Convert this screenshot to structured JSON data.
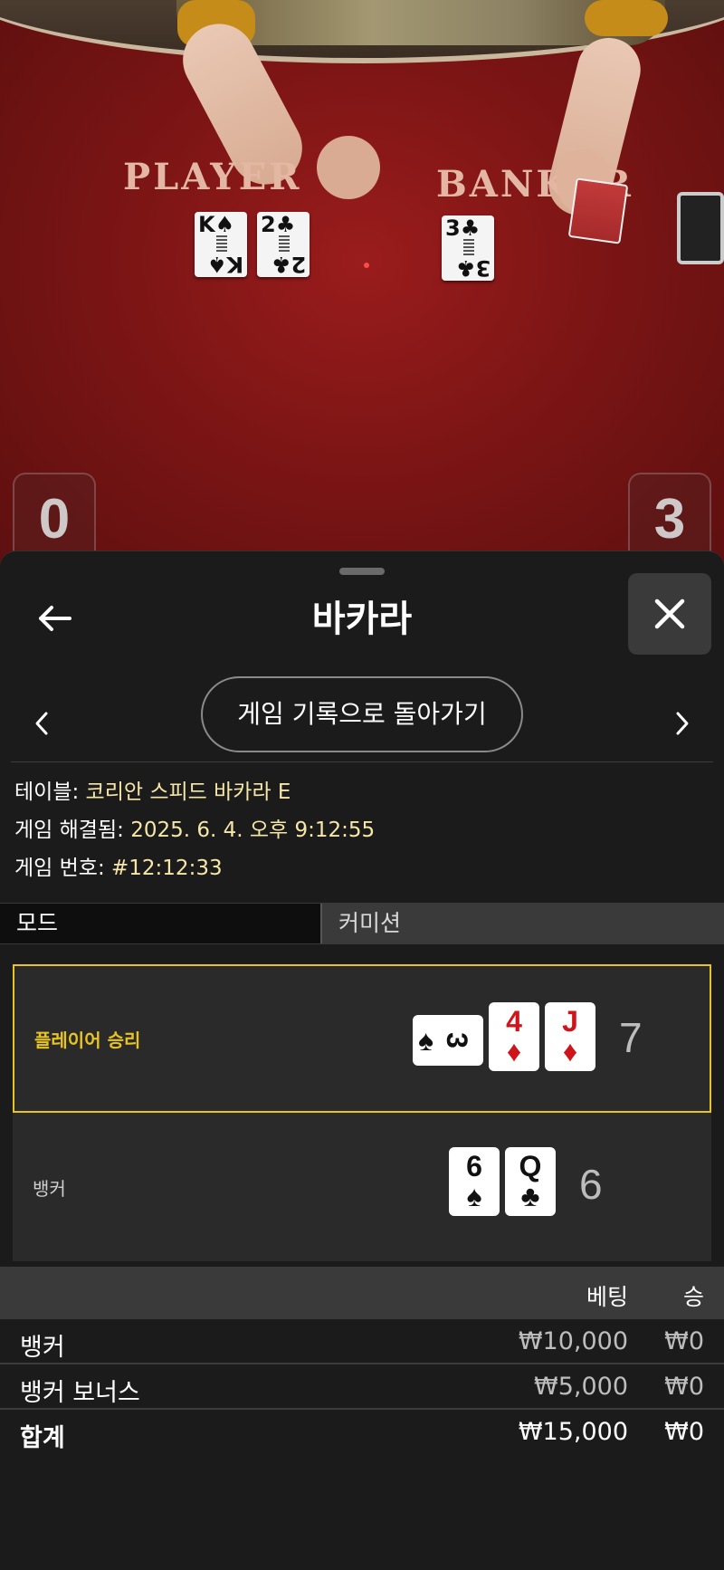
{
  "video": {
    "felt_labels": {
      "player": "PLAYER",
      "banker": "BANKER"
    },
    "table_cards": [
      {
        "rank": "K",
        "suit": "♠"
      },
      {
        "rank": "2",
        "suit": "♣"
      },
      {
        "rank": "3",
        "suit": "♣"
      }
    ],
    "scores": {
      "player": "0",
      "banker": "3"
    }
  },
  "header": {
    "title": "바카라",
    "back_icon": "arrow-left-icon",
    "close_icon": "close-icon"
  },
  "navigation": {
    "history_button": "게임 기록으로 돌아가기",
    "prev_icon": "chevron-left-icon",
    "next_icon": "chevron-right-icon"
  },
  "info": {
    "table_label": "테이블:",
    "table_value": "코리안 스피드 바카라 E",
    "resolved_label": "게임 해결됨:",
    "resolved_value": "2025. 6. 4. 오후 9:12:55",
    "number_label": "게임 번호:",
    "number_value": "#12:12:33"
  },
  "tabs": [
    {
      "label": "모드",
      "active": true
    },
    {
      "label": "커미션",
      "active": false
    }
  ],
  "hands": {
    "player": {
      "label": "플레이어 승리",
      "score": "7",
      "cards": [
        {
          "rank": "3",
          "suit": "♠",
          "orientation": "sideways"
        },
        {
          "rank": "4",
          "suit": "♦"
        },
        {
          "rank": "J",
          "suit": "♦"
        }
      ]
    },
    "banker": {
      "label": "뱅커",
      "score": "6",
      "cards": [
        {
          "rank": "6",
          "suit": "♠"
        },
        {
          "rank": "Q",
          "suit": "♣"
        }
      ]
    }
  },
  "bets": {
    "header": {
      "bet": "베팅",
      "win": "승"
    },
    "rows": [
      {
        "name": "뱅커",
        "bet": "₩10,000",
        "win": "₩0"
      },
      {
        "name": "뱅커 보너스",
        "bet": "₩5,000",
        "win": "₩0"
      }
    ],
    "total": {
      "name": "합계",
      "bet": "₩15,000",
      "win": "₩0"
    }
  },
  "colors": {
    "accent_gold": "#e7c422",
    "info_value": "#f6e7a8",
    "card_red": "#d0141b",
    "sheet_bg": "#1b1b1b"
  }
}
